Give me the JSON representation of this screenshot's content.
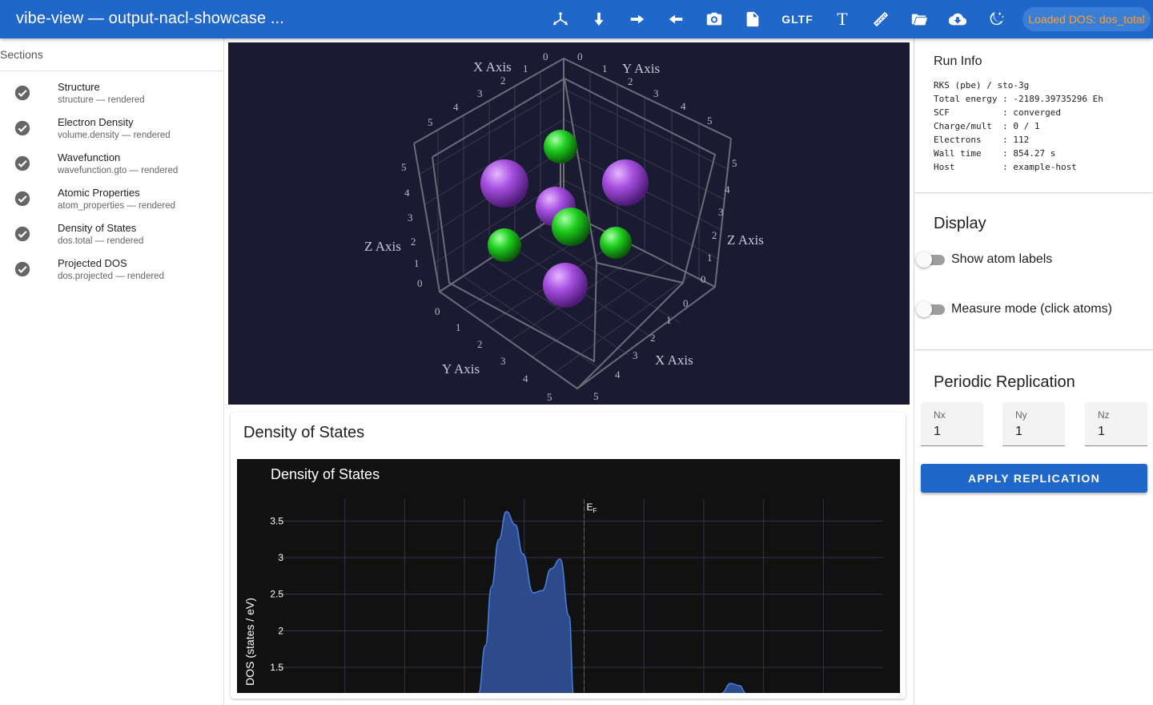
{
  "app": {
    "title": "vibe-view — output-nacl-showcase ...",
    "status_chip": "Loaded DOS: dos_total",
    "toolbar": {
      "axes_icon": "axes-icon",
      "gltf_label": "GLTF",
      "text_label": "T"
    }
  },
  "sidebar": {
    "header": "Sections",
    "items": [
      {
        "title": "Structure",
        "subtitle": "structure — rendered"
      },
      {
        "title": "Electron Density",
        "subtitle": "volume.density — rendered"
      },
      {
        "title": "Wavefunction",
        "subtitle": "wavefunction.gto — rendered"
      },
      {
        "title": "Atomic Properties",
        "subtitle": "atom_properties — rendered"
      },
      {
        "title": "Density of States",
        "subtitle": "dos.total — rendered"
      },
      {
        "title": "Projected DOS",
        "subtitle": "dos.projected — rendered"
      }
    ]
  },
  "viewer": {
    "axis_labels": {
      "x": "X Axis",
      "y": "Y Axis",
      "z": "Z Axis"
    },
    "ticks": [
      "0",
      "1",
      "2",
      "3",
      "4",
      "5"
    ],
    "colors": {
      "background": "#1b1a33",
      "sodium": "#9b4fd6",
      "chlorine": "#1fbf1f"
    }
  },
  "dos_card": {
    "title": "Density of States"
  },
  "run_info": {
    "title": "Run Info",
    "lines": [
      "RKS (pbe) / sto-3g",
      "Total energy : -2189.39735296 Eh",
      "SCF          : converged",
      "Charge/mult  : 0 / 1",
      "Electrons    : 112",
      "Wall time    : 854.27 s",
      "Host         : example-host"
    ]
  },
  "display": {
    "title": "Display",
    "show_labels": "Show atom labels",
    "measure_mode": "Measure mode (click atoms)"
  },
  "replication": {
    "title": "Periodic Replication",
    "nx_label": "Nx",
    "nx_value": "1",
    "ny_label": "Ny",
    "ny_value": "1",
    "nz_label": "Nz",
    "nz_value": "1",
    "apply_label": "APPLY REPLICATION"
  },
  "chart_data": {
    "type": "area",
    "title": "Density of States",
    "xlabel": "",
    "ylabel": "DOS (states / eV)",
    "yticks": [
      "1.5",
      "2",
      "2.5",
      "3",
      "3.5"
    ],
    "ylim": [
      1.15,
      3.8
    ],
    "xlim": [
      -10,
      10
    ],
    "fermi_label": "E",
    "fermi_subscript": "F",
    "fermi_energy": 0,
    "grid": true,
    "series": [
      {
        "x": [
          -3.53,
          -3.3,
          -3.1,
          -2.85,
          -2.6,
          -2.3,
          -2.05,
          -1.7,
          -1.4,
          -1.1,
          -0.8,
          -0.5,
          -0.35
        ],
        "y": [
          1.15,
          1.8,
          2.6,
          3.25,
          3.63,
          3.45,
          3.05,
          2.52,
          2.55,
          2.85,
          2.98,
          2.2,
          1.15
        ]
      },
      {
        "x": [
          4.6,
          4.9,
          5.2,
          5.4
        ],
        "y": [
          1.15,
          1.28,
          1.25,
          1.15
        ]
      }
    ],
    "colors": {
      "fill": "#2f4f92",
      "line": "#4a7fe0",
      "fermi": "#e03030",
      "grid": "#34344a"
    }
  }
}
